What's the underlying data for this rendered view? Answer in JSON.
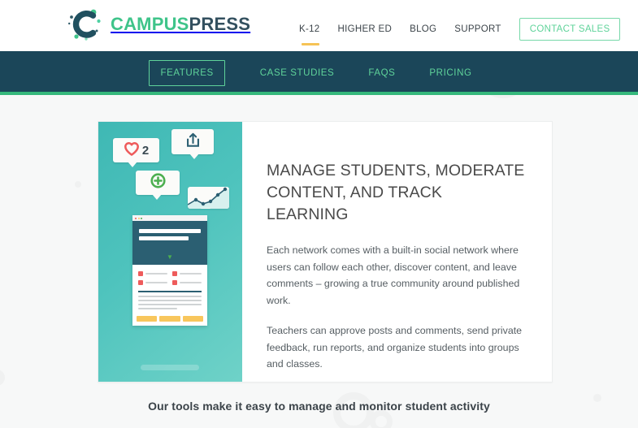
{
  "header": {
    "logo": {
      "icon": "campuspress-c-logo-icon",
      "text_primary": "CAMPUS",
      "text_secondary": "PRESS"
    },
    "nav": [
      {
        "label": "K-12",
        "active": true
      },
      {
        "label": "HIGHER ED",
        "active": false
      },
      {
        "label": "BLOG",
        "active": false
      },
      {
        "label": "SUPPORT",
        "active": false
      }
    ],
    "cta": {
      "label": "CONTACT SALES"
    }
  },
  "subnav": {
    "items": [
      {
        "label": "FEATURES",
        "boxed": true
      },
      {
        "label": "CASE STUDIES",
        "boxed": false
      },
      {
        "label": "FAQS",
        "boxed": false
      },
      {
        "label": "PRICING",
        "boxed": false
      }
    ]
  },
  "card": {
    "illustration": {
      "like_count": "2",
      "like_icon": "heart-icon",
      "share_icon": "share-upload-icon",
      "add_icon": "plus-circle-icon",
      "chart_icon": "line-chart-icon",
      "browser_icon": "browser-window-mock",
      "chevron_icon": "chevron-down-icon"
    },
    "heading": "MANAGE STUDENTS, MODERATE CONTENT, AND TRACK LEARNING",
    "paragraphs": [
      "Each network comes with a built-in social network where users can follow each other, discover content, and leave comments – growing a true community around published work.",
      "Teachers can approve posts and comments, send private feedback, run reports, and organize students into groups and classes."
    ]
  },
  "tagline": "Our tools make it easy to manage and monitor student activity",
  "colors": {
    "brand_green": "#3fc48a",
    "brand_dark": "#33505f",
    "subnav_bg": "#1b4659",
    "subnav_accent": "#35b87c",
    "subnav_link": "#5fd39a",
    "active_underline": "#f6c356",
    "illustration_teal": "#4ec3bd",
    "canvas_bg": "#f7f8f8"
  }
}
